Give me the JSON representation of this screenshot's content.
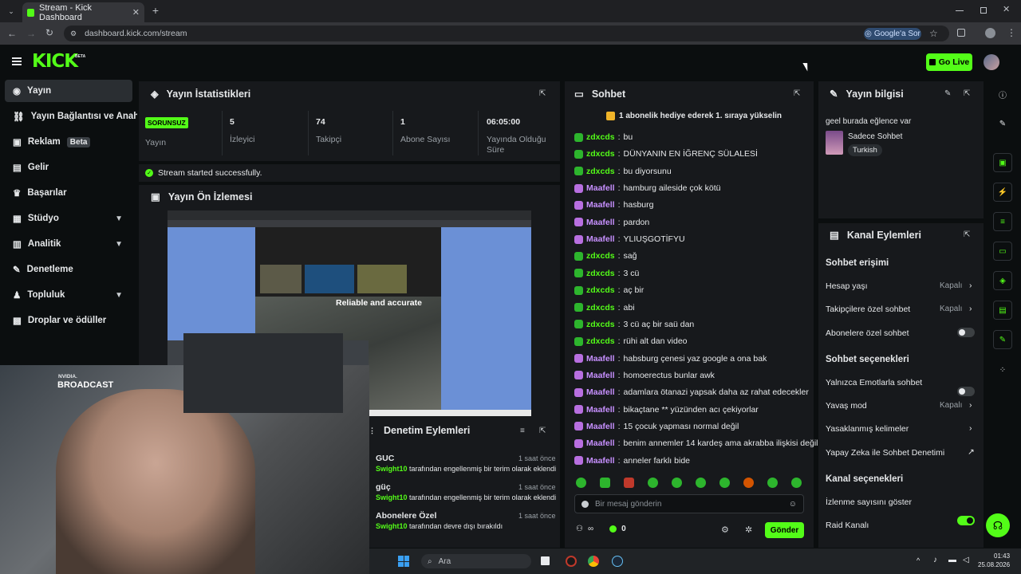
{
  "browser": {
    "tab_title": "Stream - Kick Dashboard",
    "url": "dashboard.kick.com/stream",
    "google_ask": "Google'a Sor"
  },
  "header": {
    "logo": "KICK",
    "logo_beta": "BETA",
    "go_live": "Go Live"
  },
  "sidebar": {
    "items": [
      {
        "label": "Yayın"
      },
      {
        "label": "Yayın Bağlantısı ve Anahtarı"
      },
      {
        "label": "Reklam",
        "badge": "Beta"
      },
      {
        "label": "Gelir"
      },
      {
        "label": "Başarılar"
      },
      {
        "label": "Stüdyo"
      },
      {
        "label": "Analitik"
      },
      {
        "label": "Denetleme"
      },
      {
        "label": "Topluluk"
      },
      {
        "label": "Droplar ve ödüller"
      }
    ]
  },
  "stats": {
    "title": "Yayın İstatistikleri",
    "status_badge": "SORUNSUZ",
    "status_label": "Yayın",
    "viewers_value": "5",
    "viewers_label": "İzleyici",
    "followers_value": "74",
    "followers_label": "Takipçi",
    "subs_value": "1",
    "subs_label": "Abone Sayısı",
    "uptime_value": "06:05:00",
    "uptime_label": "Yayında Olduğu Süre",
    "started_msg": "Stream started successfully."
  },
  "preview": {
    "title": "Yayın Ön İzlemesi",
    "overlay_text": "Reliable and accurate"
  },
  "chat": {
    "title": "Sohbet",
    "pinned": "1 abonelik hediye ederek 1. sıraya yükselin",
    "messages": [
      {
        "user": "zdxcds",
        "text": "bu"
      },
      {
        "user": "zdxcds",
        "text": "DÜNYANIN EN İĞRENÇ SÜLALESİ"
      },
      {
        "user": "zdxcds",
        "text": "bu diyorsunu"
      },
      {
        "user": "Maafell",
        "text": "hamburg aileside çok kötü"
      },
      {
        "user": "Maafell",
        "text": "hasburg"
      },
      {
        "user": "Maafell",
        "text": "pardon"
      },
      {
        "user": "Maafell",
        "text": "YLIUŞGOTİFYU"
      },
      {
        "user": "zdxcds",
        "text": "sağ"
      },
      {
        "user": "zdxcds",
        "text": "3 cü"
      },
      {
        "user": "zdxcds",
        "text": "aç bir"
      },
      {
        "user": "zdxcds",
        "text": "abi"
      },
      {
        "user": "zdxcds",
        "text": "3 cü aç bir saü dan"
      },
      {
        "user": "zdxcds",
        "text": "rühi alt dan video"
      },
      {
        "user": "Maafell",
        "text": "habsburg çenesi yaz google a ona bak"
      },
      {
        "user": "Maafell",
        "text": "homoerectus bunlar awk"
      },
      {
        "user": "Maafell",
        "text": "adamlara ötanazi yapsak daha az rahat edecekler"
      },
      {
        "user": "Maafell",
        "text": "bikaçtane ** yüzünden acı çekiyorlar"
      },
      {
        "user": "Maafell",
        "text": "15 çocuk yapması normal değil"
      },
      {
        "user": "Maafell",
        "text": "benim annemler 14 kardeş ama akrabba ilişkisi değil"
      },
      {
        "user": "Maafell",
        "text": "anneler farklı bide"
      }
    ],
    "input_placeholder": "Bir mesaj gönderin",
    "points": "0",
    "send": "Gönder"
  },
  "info": {
    "title": "Yayın bilgisi",
    "stream_title": "geel burada eğlence var",
    "category": "Sadece Sohbet",
    "language": "Turkish"
  },
  "channel_actions": {
    "title": "Kanal Eylemleri",
    "chat_access": "Sohbet erişimi",
    "account_age": "Hesap yaşı",
    "account_age_val": "Kapalı",
    "followers_only": "Takipçilere özel sohbet",
    "followers_only_val": "Kapalı",
    "subs_only": "Abonelere özel sohbet",
    "chat_options": "Sohbet seçenekleri",
    "emote_only": "Yalnızca Emotlarla sohbet",
    "slow_mode": "Yavaş mod",
    "slow_mode_val": "Kapalı",
    "banned_words": "Yasaklanmış kelimeler",
    "ai_mod": "Yapay Zeka ile Sohbet Denetimi",
    "channel_options": "Kanal seçenekleri",
    "show_viewers": "İzlenme sayısını göster",
    "raid": "Raid Kanalı"
  },
  "mod_actions": {
    "title": "Denetim Eylemleri",
    "items": [
      {
        "term": "GUC",
        "time": "1 saat önce",
        "by": "Swight10",
        "desc": "tarafından engellenmiş bir terim olarak eklendi"
      },
      {
        "term": "güç",
        "time": "1 saat önce",
        "by": "Swight10",
        "desc": "tarafından engellenmiş bir terim olarak eklendi"
      },
      {
        "term": "Abonelere Özel",
        "time": "1 saat önce",
        "by": "Swight10",
        "desc": "tarafından devre dışı bırakıldı"
      }
    ]
  },
  "overlay": {
    "nvidia": "NVIDIA.",
    "broadcast": "BROADCAST"
  },
  "taskbar": {
    "search": "Ara",
    "time": "01:43",
    "date": "25.08.2026"
  },
  "colors": {
    "accent": "#53fc18",
    "panel": "#17191c",
    "background": "#0b0e0f"
  }
}
